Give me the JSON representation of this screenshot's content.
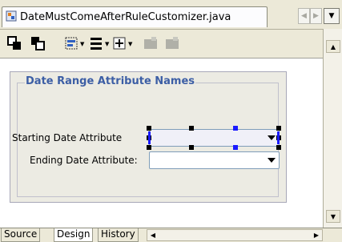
{
  "editor_tab": {
    "title": "DateMustComeAfterRuleCustomizer.java"
  },
  "panel": {
    "group_title": "Date Range Attribute Names",
    "fields": [
      {
        "label": "Starting Date Attribute",
        "value": ""
      },
      {
        "label": "Ending Date Attribute:",
        "value": ""
      }
    ]
  },
  "bottom_tabs": [
    {
      "label": "Source",
      "active": false
    },
    {
      "label": "Design",
      "active": true
    },
    {
      "label": "History",
      "active": false
    }
  ],
  "colors": {
    "group_title": "#3c5ea5",
    "selection_handle": "#000000",
    "selection_handle_blue": "#1a1aff",
    "panel_background": "#ecebe3"
  },
  "icons": [
    "java-file-icon",
    "bring-to-front-icon",
    "send-to-back-icon",
    "align-icon",
    "distribute-icon",
    "anchor-icon",
    "gear-icon",
    "gear-icon",
    "scroll-left-icon",
    "scroll-right-icon",
    "dropdown-icon"
  ]
}
